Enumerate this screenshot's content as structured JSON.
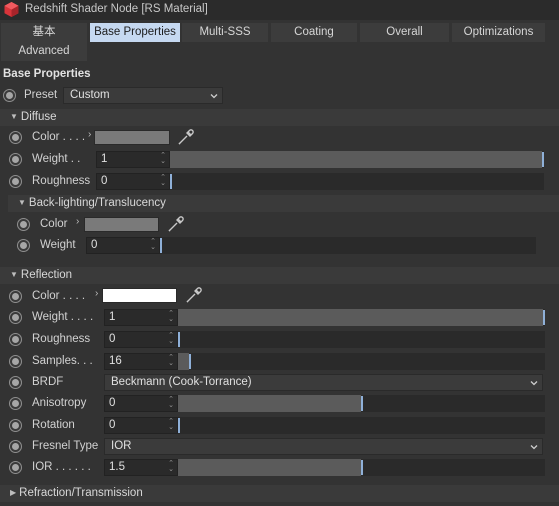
{
  "window": {
    "title": "Redshift Shader Node [RS Material]"
  },
  "tabs": [
    {
      "label": "基本"
    },
    {
      "label": "Base Properties"
    },
    {
      "label": "Multi-SSS"
    },
    {
      "label": "Coating"
    },
    {
      "label": "Overall"
    },
    {
      "label": "Optimizations"
    },
    {
      "label": "Advanced"
    }
  ],
  "base": {
    "heading": "Base Properties",
    "preset_label": "Preset",
    "preset_value": "Custom"
  },
  "diffuse": {
    "heading": "Diffuse",
    "color_label": "Color . . . .",
    "color_value": "#7a7a7a",
    "weight_label": "Weight . .",
    "weight_value": "1",
    "weight_level": 1.0,
    "roughness_label": "Roughness",
    "roughness_value": "0",
    "roughness_level": 0.0
  },
  "backlighting": {
    "heading": "Back-lighting/Translucency",
    "color_label": "Color",
    "color_value": "#7a7a7a",
    "weight_label": "Weight",
    "weight_value": "0",
    "weight_level": 0.0
  },
  "reflection": {
    "heading": "Reflection",
    "color_label": "Color . . . .",
    "color_value": "#ffffff",
    "weight_label": "Weight . . . .",
    "weight_value": "1",
    "weight_level": 1.0,
    "roughness_label": "Roughness",
    "roughness_value": "0",
    "roughness_level": 0.0,
    "samples_label": "Samples. . .",
    "samples_value": "16",
    "samples_level": 0.03,
    "brdf_label": "BRDF",
    "brdf_value": "Beckmann (Cook-Torrance)",
    "anisotropy_label": "Anisotropy",
    "anisotropy_value": "0",
    "anisotropy_level": 0.5,
    "rotation_label": "Rotation",
    "rotation_value": "0",
    "rotation_level": 0.0,
    "fresnel_label": "Fresnel Type",
    "fresnel_value": "IOR",
    "ior_label": "IOR . . . . . .",
    "ior_value": "1.5",
    "ior_level": 0.5
  },
  "refraction": {
    "heading": "Refraction/Transmission"
  },
  "icons": {
    "app": "redshift-cube-icon",
    "pipette": "eyedropper-icon",
    "keyframe": "animation-dot-icon",
    "expand": "chevron-right-icon",
    "collapse": "triangle-down-icon",
    "dropdown": "chevron-down-icon"
  },
  "colors": {
    "active_tab": "#c6d9f1",
    "slider_marker": "#8fb0d8",
    "app_icon": "#d8343a"
  }
}
